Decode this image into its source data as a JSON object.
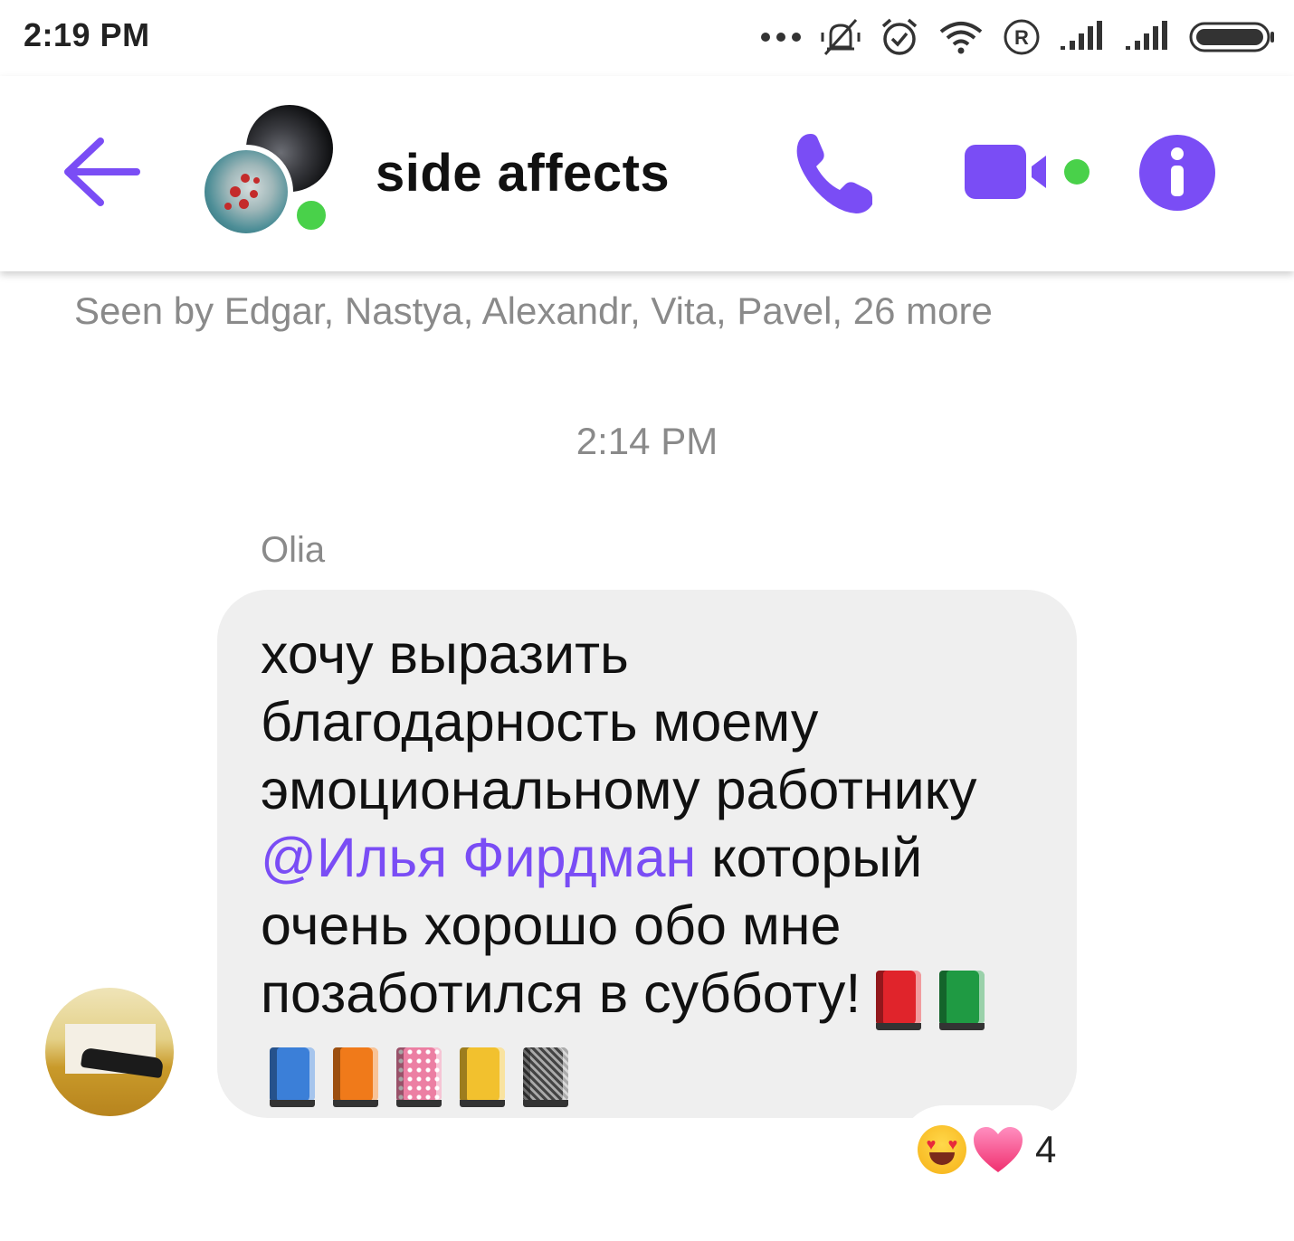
{
  "status_bar": {
    "time": "2:19 PM",
    "icons": [
      "more-dots-icon",
      "vibrate-silent-icon",
      "alarm-icon",
      "wifi-icon",
      "roaming-r-icon",
      "signal-icon",
      "signal-icon",
      "battery-icon"
    ]
  },
  "header": {
    "title": "side affects",
    "online": true
  },
  "conversation": {
    "seen_by": "Seen by Edgar, Nastya, Alexandr, Vita, Pavel, 26 more",
    "timestamp": "2:14 PM",
    "message": {
      "sender": "Olia",
      "text_before_mention": "хочу выразить\nблагодарность моему\nэмоциональному работнику\n",
      "mention": "@Илья Фирдман",
      "text_after_mention": " который\nочень хорошо обо мне\nпозаботился в субботу! ",
      "emojis": [
        "closed-book",
        "green-book",
        "blue-book",
        "orange-book",
        "notebook-decorative-cover",
        "ledger",
        "notebook"
      ],
      "reactions": {
        "emojis": [
          "smiling-face-with-heart-eyes",
          "pink-heart"
        ],
        "count": "4"
      }
    }
  },
  "colors": {
    "accent": "#7a4df5",
    "online_green": "#49d14a",
    "bubble_bg": "#efefef",
    "meta_text": "#8a8a8a"
  }
}
